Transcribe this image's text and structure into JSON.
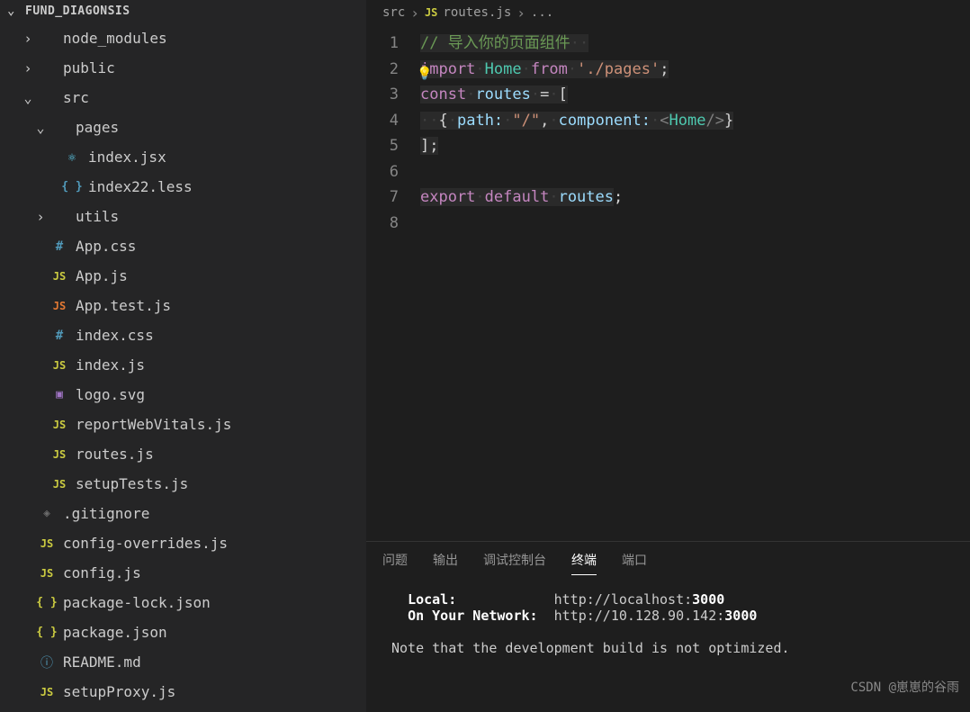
{
  "explorer": {
    "root": "FUND_DIAGONSIS",
    "items": [
      {
        "indent": 1,
        "chev": "›",
        "icon": "",
        "iconClass": "",
        "label": "node_modules"
      },
      {
        "indent": 1,
        "chev": "›",
        "icon": "",
        "iconClass": "",
        "label": "public"
      },
      {
        "indent": 1,
        "chev": "⌄",
        "icon": "",
        "iconClass": "",
        "label": "src"
      },
      {
        "indent": 2,
        "chev": "⌄",
        "icon": "",
        "iconClass": "",
        "label": "pages"
      },
      {
        "indent": 3,
        "chev": "",
        "icon": "⚛",
        "iconClass": "ic-react",
        "label": "index.jsx"
      },
      {
        "indent": 3,
        "chev": "",
        "icon": "{ }",
        "iconClass": "ic-less",
        "label": "index22.less"
      },
      {
        "indent": 2,
        "chev": "›",
        "icon": "",
        "iconClass": "",
        "label": "utils"
      },
      {
        "indent": 2,
        "chev": "",
        "icon": "#",
        "iconClass": "ic-css",
        "label": "App.css"
      },
      {
        "indent": 2,
        "chev": "",
        "icon": "JS",
        "iconClass": "ic-js",
        "label": "App.js"
      },
      {
        "indent": 2,
        "chev": "",
        "icon": "JS",
        "iconClass": "ic-jstest",
        "label": "App.test.js"
      },
      {
        "indent": 2,
        "chev": "",
        "icon": "#",
        "iconClass": "ic-css",
        "label": "index.css"
      },
      {
        "indent": 2,
        "chev": "",
        "icon": "JS",
        "iconClass": "ic-js",
        "label": "index.js"
      },
      {
        "indent": 2,
        "chev": "",
        "icon": "▣",
        "iconClass": "ic-svg",
        "label": "logo.svg"
      },
      {
        "indent": 2,
        "chev": "",
        "icon": "JS",
        "iconClass": "ic-js",
        "label": "reportWebVitals.js"
      },
      {
        "indent": 2,
        "chev": "",
        "icon": "JS",
        "iconClass": "ic-js",
        "label": "routes.js"
      },
      {
        "indent": 2,
        "chev": "",
        "icon": "JS",
        "iconClass": "ic-js",
        "label": "setupTests.js"
      },
      {
        "indent": 1,
        "chev": "",
        "icon": "◈",
        "iconClass": "ic-git",
        "label": ".gitignore"
      },
      {
        "indent": 1,
        "chev": "",
        "icon": "JS",
        "iconClass": "ic-js",
        "label": "config-overrides.js"
      },
      {
        "indent": 1,
        "chev": "",
        "icon": "JS",
        "iconClass": "ic-js",
        "label": "config.js"
      },
      {
        "indent": 1,
        "chev": "",
        "icon": "{ }",
        "iconClass": "ic-json",
        "label": "package-lock.json"
      },
      {
        "indent": 1,
        "chev": "",
        "icon": "{ }",
        "iconClass": "ic-json",
        "label": "package.json"
      },
      {
        "indent": 1,
        "chev": "",
        "icon": "ⓘ",
        "iconClass": "ic-info",
        "label": "README.md"
      },
      {
        "indent": 1,
        "chev": "",
        "icon": "JS",
        "iconClass": "ic-js",
        "label": "setupProxy.js"
      }
    ]
  },
  "breadcrumb": {
    "seg1": "src",
    "icon": "JS",
    "seg2": "routes.js",
    "seg3": "..."
  },
  "editor": {
    "lines": [
      1,
      2,
      3,
      4,
      5,
      6,
      7,
      8
    ],
    "code": {
      "l1_comment": "// 导入你的页面组件",
      "l2_import": "import",
      "l2_home": "Home",
      "l2_from": "from",
      "l2_path": "'./pages'",
      "l2_semi": ";",
      "l3_const": "const",
      "l3_routes": "routes",
      "l3_eq": "=",
      "l3_brk": "[",
      "l4_open": "{",
      "l4_path_key": "path:",
      "l4_path_val": "\"/\"",
      "l4_comma": ",",
      "l4_comp_key": "component:",
      "l4_tag_open": "<",
      "l4_comp": "Home",
      "l4_tag_close": "/>",
      "l4_close": "}",
      "l5_close": "];",
      "l7_export": "export",
      "l7_default": "default",
      "l7_routes": "routes",
      "l7_semi": ";"
    }
  },
  "terminal": {
    "tabs": [
      "问题",
      "输出",
      "调试控制台",
      "终端",
      "端口"
    ],
    "active": 3,
    "local_label": "Local:",
    "local_url": "http://localhost:",
    "local_port": "3000",
    "network_label": "On Your Network:",
    "network_url": "http://10.128.90.142:",
    "network_port": "3000",
    "note": "Note that the development build is not optimized."
  },
  "watermark": "CSDN @崽崽的谷雨"
}
